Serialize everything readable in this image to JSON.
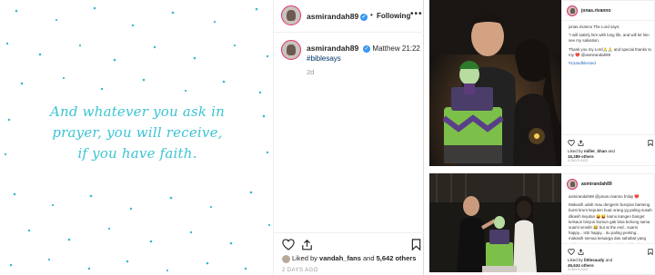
{
  "post1": {
    "quote_lines": [
      "And whatever you ask in",
      "prayer, you will receive,",
      "if you have faith."
    ],
    "username": "asmirandah89",
    "verified_mark": "✓",
    "follow_separator": "•",
    "follow_label": "Following",
    "more_label": "•••",
    "caption_ref": "Matthew 21:22",
    "caption_tag": "#biblesays",
    "caption_time": "2d",
    "likes_prefix": "Liked by",
    "likes_user": "vandah_fans",
    "likes_middle": "and",
    "likes_count": "5,642 others",
    "date": "2 DAYS AGO"
  },
  "post2": {
    "username": "jonas.rivanno",
    "caption_lines": [
      "jonas.rivanno The Lord says:",
      "\"I will satisfy him with long life, and will let him see my salvation.",
      "Thank you my Lord🙏🙏 and special thanks to my ❤️ @asmirandah89",
      "#12andblessed"
    ],
    "likes_prefix": "Liked by",
    "likes_user": "miller_khan",
    "likes_suffix": "and",
    "likes_count": "15,289 others",
    "date": "4 DAYS AGO"
  },
  "post3": {
    "username": "asmirandah89",
    "caption_lines": [
      "asmirandah89 @jonas.rivanno b'day ❤️",
      "Makasih udah mau dengerin bunyian banteng burst brum keputen buat orang yg paling susah dikasih kejutan 😝😝 kamu kangen banget kelsaun binyun bumun gak bisa bohong sama suami sendiri 😂 but at the end.. suami happy... istri happy... itu paling penting.. makasih semua keluarga dan sahabat yang udah mau repot-repot bantuin kami berdua kemarin yang udah mau sampe sini 😍 thank you so much ❤️❤️❤️"
    ],
    "likes_prefix": "Liked by",
    "likes_user": "littlesaudy",
    "likes_suffix": "and",
    "likes_count": "45,634 others",
    "date": "4 DAYS AGO"
  },
  "colors": {
    "quote_teal": "#3cc4d4",
    "verified_blue": "#3897f0",
    "story_ring": "#e1306c",
    "hashtag": "#003569"
  }
}
